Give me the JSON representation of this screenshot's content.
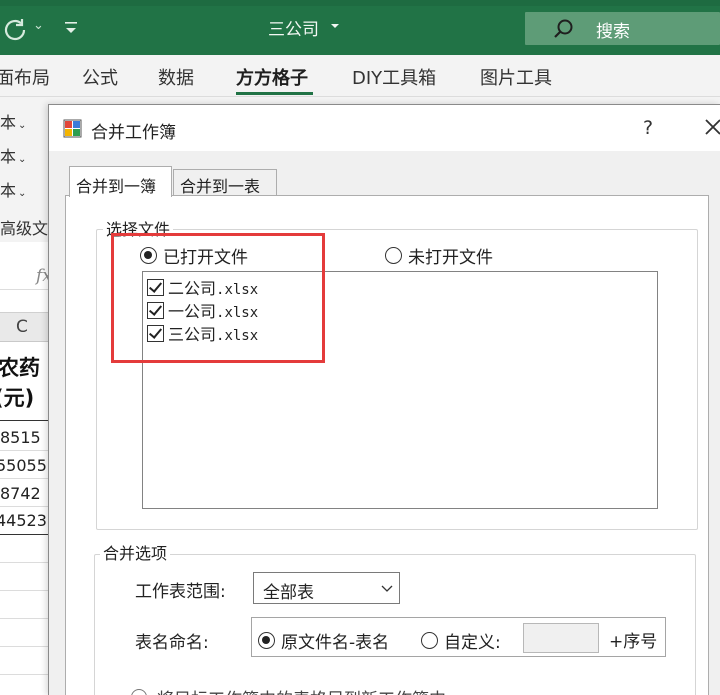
{
  "excel": {
    "doc_title": "三公司",
    "search_label": "搜索",
    "ribbon_tabs": [
      {
        "label": "面布局"
      },
      {
        "label": "公式"
      },
      {
        "label": "数据"
      },
      {
        "label": "方方格子",
        "active": true
      },
      {
        "label": "DIY工具箱"
      },
      {
        "label": "图片工具"
      }
    ],
    "ribbon_items": [
      "本",
      "本",
      "本",
      "高级文"
    ],
    "sheet": {
      "formula_label": "fx",
      "column_header": "C",
      "header_line1": "农药",
      "header_line2": "(元)",
      "values": [
        "8515",
        "55055",
        "8742",
        "44523"
      ]
    },
    "theme": {
      "accent": "#217346",
      "highlight": "#e43b3b"
    }
  },
  "dialog": {
    "title": "合并工作簿",
    "help_symbol": "?",
    "tabs": [
      {
        "label": "合并到一簿",
        "selected": true
      },
      {
        "label": "合并到一表",
        "selected": false
      }
    ],
    "select_files": {
      "legend": "选择文件",
      "option_opened": "已打开文件",
      "option_unopened": "未打开文件",
      "selected_option": "已打开文件",
      "files": [
        {
          "name": "二公司",
          "ext": ".xlsx",
          "checked": true
        },
        {
          "name": "一公司",
          "ext": ".xlsx",
          "checked": true
        },
        {
          "name": "三公司",
          "ext": ".xlsx",
          "checked": true
        }
      ]
    },
    "merge_options": {
      "legend": "合并选项",
      "sheet_range_label": "工作表范围:",
      "sheet_range_value": "全部表",
      "naming_label": "表名命名:",
      "naming_option_1": "原文件名-表名",
      "naming_option_2": "自定义:",
      "custom_value": "",
      "suffix_label": "+序号",
      "selected_naming": "原文件名-表名"
    },
    "bottom_option_text": "将目标工作簿中的表格另到新工作簿中"
  }
}
